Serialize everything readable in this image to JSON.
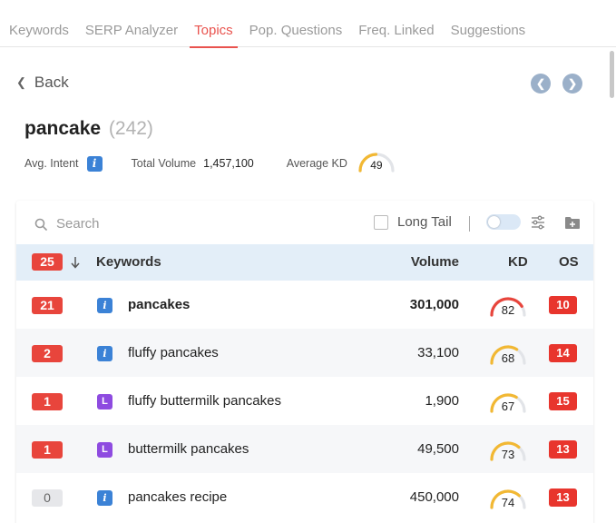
{
  "tabs": [
    {
      "label": "Keywords",
      "active": false
    },
    {
      "label": "SERP Analyzer",
      "active": false
    },
    {
      "label": "Topics",
      "active": true
    },
    {
      "label": "Pop. Questions",
      "active": false
    },
    {
      "label": "Freq. Linked",
      "active": false
    },
    {
      "label": "Suggestions",
      "active": false
    }
  ],
  "nav": {
    "back_label": "Back"
  },
  "topic": {
    "name": "pancake",
    "count": "(242)",
    "avg_intent_label": "Avg. Intent",
    "avg_intent_badge": "i",
    "total_volume_label": "Total Volume",
    "total_volume": "1,457,100",
    "average_kd_label": "Average KD",
    "average_kd": "49"
  },
  "toolbar": {
    "search_placeholder": "Search",
    "long_tail_label": "Long Tail"
  },
  "table": {
    "headers": {
      "position": "25",
      "keywords": "Keywords",
      "volume": "Volume",
      "kd": "KD",
      "os": "OS"
    },
    "rows": [
      {
        "position": "21",
        "intent": "i",
        "keyword": "pancakes",
        "volume": "301,000",
        "kd": "82",
        "os": "10",
        "bold": true
      },
      {
        "position": "2",
        "intent": "i",
        "keyword": "fluffy pancakes",
        "volume": "33,100",
        "kd": "68",
        "os": "14",
        "bold": false
      },
      {
        "position": "1",
        "intent": "L",
        "keyword": "fluffy buttermilk pancakes",
        "volume": "1,900",
        "kd": "67",
        "os": "15",
        "bold": false
      },
      {
        "position": "1",
        "intent": "L",
        "keyword": "buttermilk pancakes",
        "volume": "49,500",
        "kd": "73",
        "os": "13",
        "bold": false
      },
      {
        "position": "0",
        "intent": "i",
        "keyword": "pancakes recipe",
        "volume": "450,000",
        "kd": "74",
        "os": "13",
        "bold": false
      }
    ]
  },
  "colors": {
    "accent": "#e9534e",
    "kd_hard": "#e8453c",
    "kd_medium": "#f2b833",
    "gauge_track": "#e2e4e8"
  }
}
